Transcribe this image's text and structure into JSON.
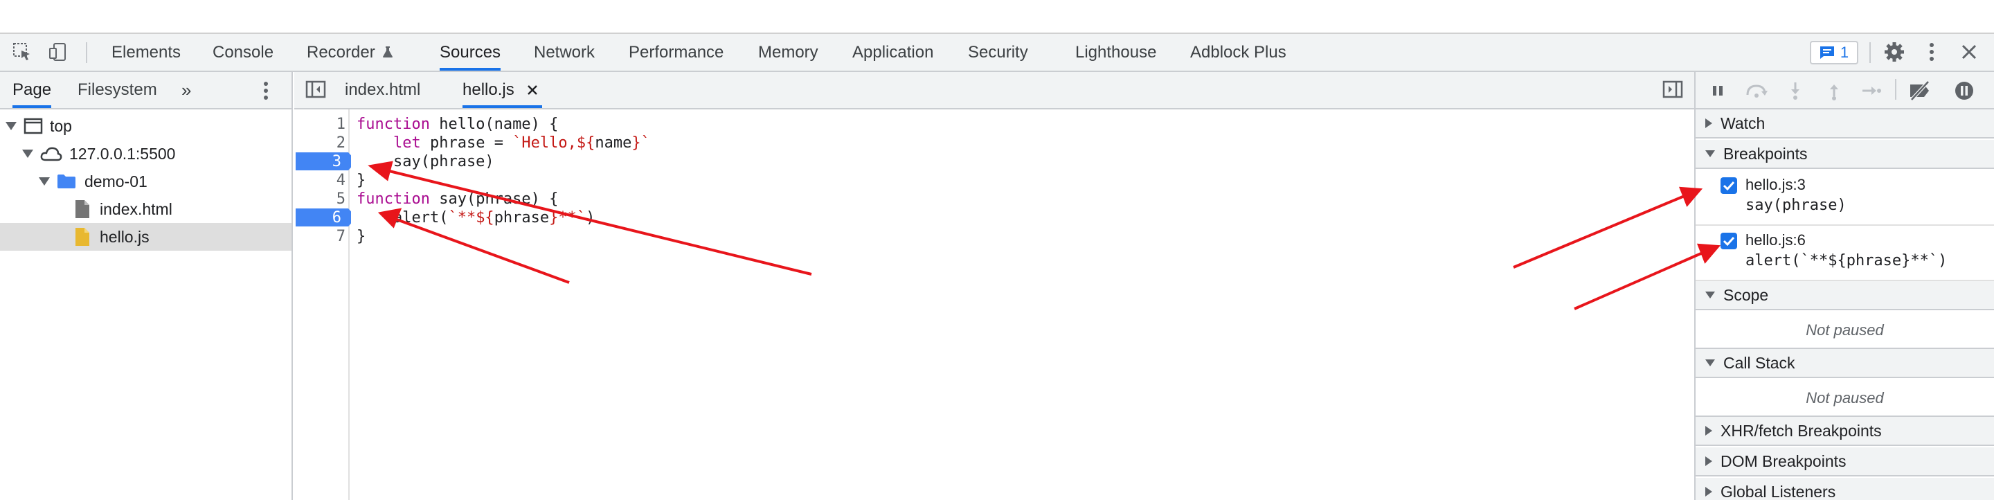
{
  "toolbar": {
    "tabs": [
      "Elements",
      "Console",
      "Recorder",
      "Sources",
      "Network",
      "Performance",
      "Memory",
      "Application",
      "Security",
      "Lighthouse",
      "Adblock Plus"
    ],
    "active_tab": "Sources",
    "issues_count": "1"
  },
  "navigator": {
    "tabs": [
      "Page",
      "Filesystem"
    ],
    "tree": {
      "top": "top",
      "origin": "127.0.0.1:5500",
      "folder": "demo-01",
      "files": [
        "index.html",
        "hello.js"
      ]
    },
    "selected_file": "hello.js"
  },
  "editor": {
    "tabs": [
      "index.html",
      "hello.js"
    ],
    "active_tab": "hello.js",
    "line_numbers": [
      "1",
      "2",
      "3",
      "4",
      "5",
      "6",
      "7"
    ],
    "breakpoint_lines": [
      "3",
      "6"
    ],
    "code": {
      "l1_kw": "function",
      "l1_rest": " hello(name) {",
      "l2_indent": "    ",
      "l2_kw": "let",
      "l2_mid": " phrase = ",
      "l2_str1": "`Hello,${",
      "l2_var": "name",
      "l2_str2": "}`",
      "l3": "    say(phrase)",
      "l4": "}",
      "l5_kw": "function",
      "l5_rest": " say(phrase) {",
      "l6_pre": "    alert(",
      "l6_str1": "`**${",
      "l6_var": "phrase",
      "l6_str2": "}**`",
      "l6_post": ")",
      "l7": "}"
    }
  },
  "debugger": {
    "sections": {
      "watch": "Watch",
      "breakpoints": "Breakpoints",
      "scope": "Scope",
      "call_stack": "Call Stack",
      "xhr": "XHR/fetch Breakpoints",
      "dom": "DOM Breakpoints",
      "global": "Global Listeners"
    },
    "breakpoints": [
      {
        "file": "hello.js:3",
        "code": "say(phrase)",
        "checked": true
      },
      {
        "file": "hello.js:6",
        "code": "alert(`**${phrase}**`)",
        "checked": true
      }
    ],
    "scope_status": "Not paused",
    "call_stack_status": "Not paused"
  },
  "colors": {
    "accent": "#1a73e8",
    "breakpoint": "#4285f4",
    "annotation_arrow": "#e8151b",
    "keyword": "#aa0d91",
    "string": "#c41a16"
  }
}
